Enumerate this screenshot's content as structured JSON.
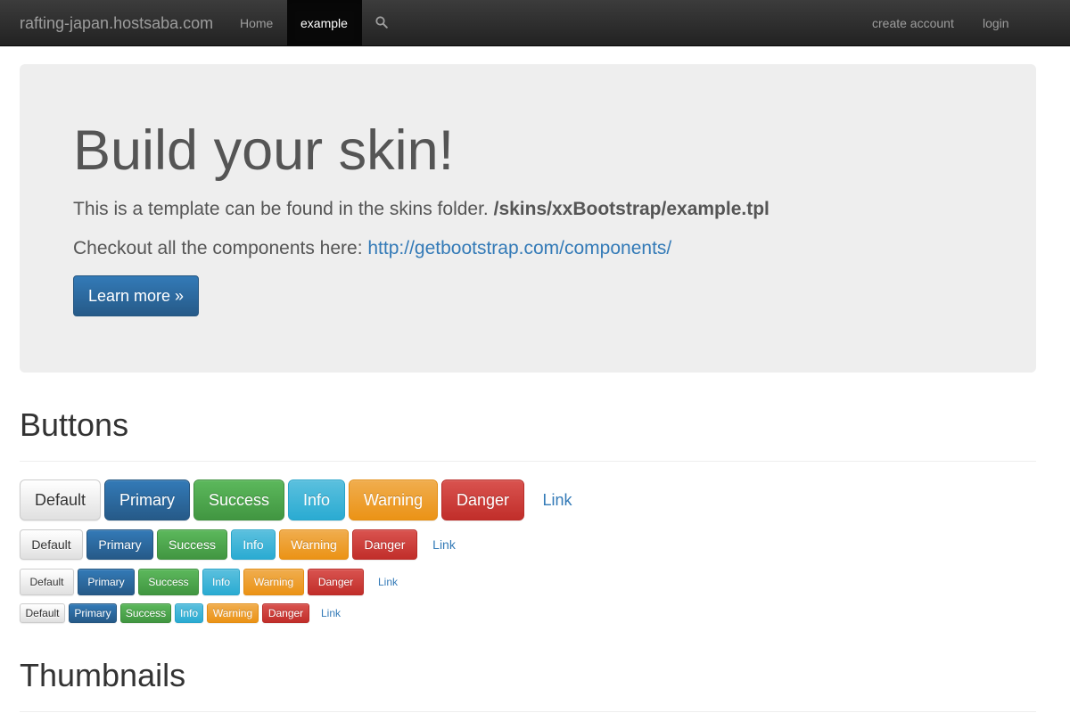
{
  "navbar": {
    "brand": "rafting-japan.hostsaba.com",
    "items": [
      {
        "label": "Home"
      },
      {
        "label": "example",
        "active": true
      }
    ],
    "search_icon": "search-icon",
    "right_items": [
      {
        "label": "create account"
      },
      {
        "label": "login"
      }
    ]
  },
  "jumbotron": {
    "title": "Build your skin!",
    "text1": "This is a template can be found in the skins folder.",
    "path": "/skins/xxBootstrap/example.tpl",
    "text2": "Checkout all the components here:",
    "link": "http://getbootstrap.com/components/",
    "button": "Learn more »"
  },
  "sections": {
    "buttons_title": "Buttons",
    "thumbnails_title": "Thumbnails"
  },
  "button_labels": {
    "default": "Default",
    "primary": "Primary",
    "success": "Success",
    "info": "Info",
    "warning": "Warning",
    "danger": "Danger",
    "link": "Link"
  },
  "colors": {
    "primary": "#337ab7",
    "success": "#5cb85c",
    "info": "#5bc0de",
    "warning": "#f0ad4e",
    "danger": "#d9534f",
    "navbar": "#222222",
    "jumbotron": "#eeeeee"
  }
}
